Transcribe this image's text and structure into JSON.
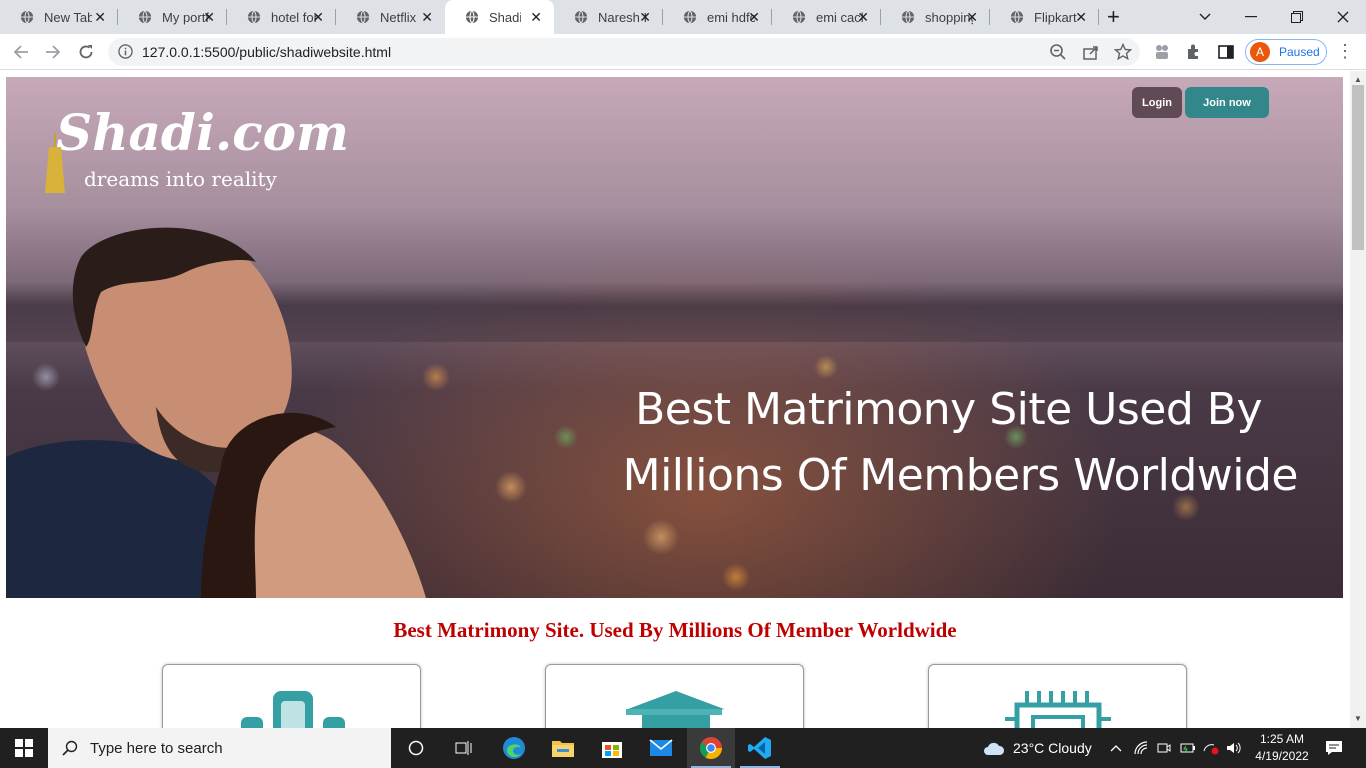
{
  "browser": {
    "tabs": [
      {
        "label": "New Tab"
      },
      {
        "label": "My portfolio"
      },
      {
        "label": "hotel for"
      },
      {
        "label": "Netflix"
      },
      {
        "label": "Shadi website"
      },
      {
        "label": "Naresh IT"
      },
      {
        "label": "emi hdfc"
      },
      {
        "label": "emi cacl"
      },
      {
        "label": "shopping"
      },
      {
        "label": "Flipkart"
      }
    ],
    "active_tab_index": 4,
    "url": "127.0.0.1:5500/public/shadiwebsite.html",
    "profile_initial": "A",
    "profile_status": "Paused"
  },
  "page": {
    "logo": {
      "brand": "Shadi.com",
      "tagline": "dreams into reality"
    },
    "header_buttons": {
      "login": "Login",
      "join": "Join now"
    },
    "hero_headline": {
      "line1": "Best Matrimony Site Used By",
      "line2": "Millions Of Members Worldwide"
    },
    "subheading": "Best Matrimony Site. Used By Millions Of Member Worldwide",
    "cards": [
      {
        "icon": "people-icon"
      },
      {
        "icon": "graduation-cap-icon"
      },
      {
        "icon": "chip-icon"
      }
    ]
  },
  "taskbar": {
    "search_placeholder": "Type here to search",
    "weather": "23°C  Cloudy",
    "time": "1:25 AM",
    "date": "4/19/2022"
  },
  "colors": {
    "join_button": "#31878a",
    "login_button": "#5f4a56",
    "subheading": "#c00000",
    "card_icon": "#35a0a4"
  }
}
